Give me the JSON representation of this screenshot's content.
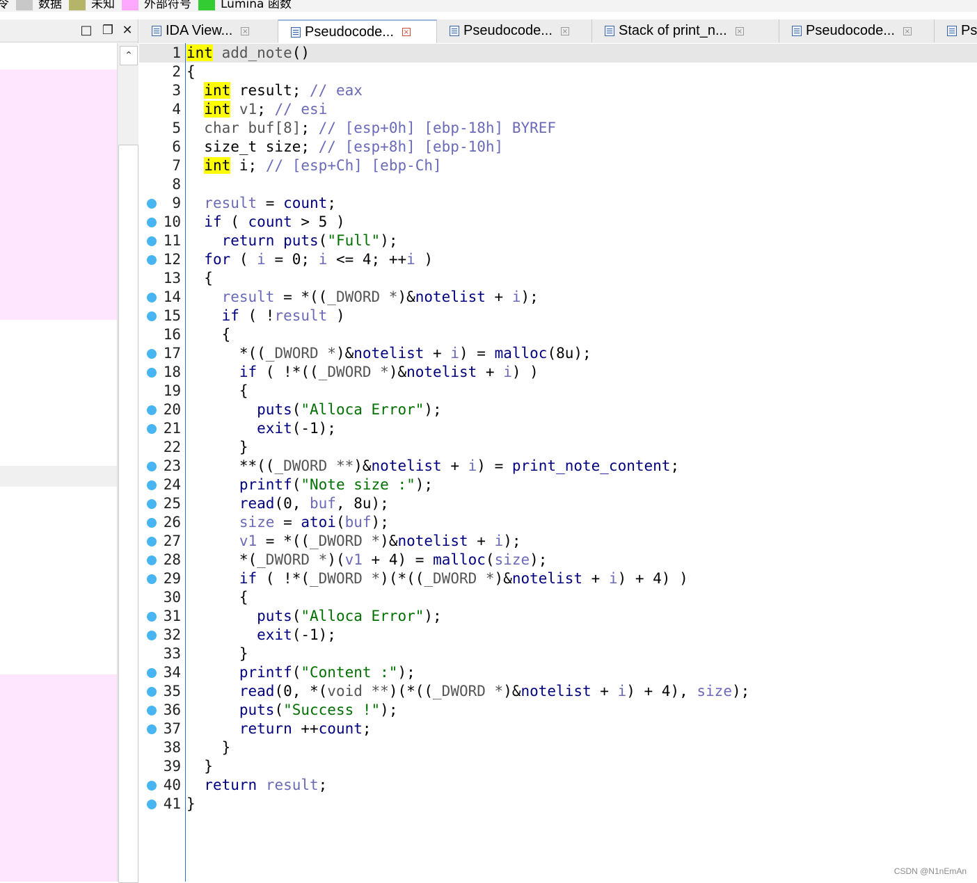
{
  "legend": {
    "items": [
      {
        "label": "令",
        "color": ""
      },
      {
        "label": "数据",
        "color": "#c8c8c8"
      },
      {
        "label": "未知",
        "color": "#b5b56a"
      },
      {
        "label": "外部符号",
        "color": "#ffa8ff"
      },
      {
        "label": "Lumina 函数",
        "color": "#33cc33"
      }
    ]
  },
  "left_panel": {
    "band_colors": {
      "pink": "#ffe6ff",
      "gray": "#f0f0f0"
    }
  },
  "tabs": [
    {
      "label": "IDA View...",
      "active": false
    },
    {
      "label": "Pseudocode...",
      "active": true
    },
    {
      "label": "Pseudocode...",
      "active": false
    },
    {
      "label": "Stack of print_n...",
      "active": false
    },
    {
      "label": "Pseudocode...",
      "active": false
    },
    {
      "label": "Ps",
      "active": false
    }
  ],
  "code": {
    "lines": [
      {
        "n": "1",
        "bp": false,
        "t": [
          [
            "ty",
            "int"
          ],
          [
            "pl",
            " "
          ],
          [
            "gy",
            "add_note"
          ],
          [
            "pl",
            "()"
          ]
        ]
      },
      {
        "n": "2",
        "bp": false,
        "t": [
          [
            "pl",
            "{"
          ]
        ]
      },
      {
        "n": "3",
        "bp": false,
        "t": [
          [
            "pl",
            "  "
          ],
          [
            "ty",
            "int"
          ],
          [
            "pl",
            " result; "
          ],
          [
            "cm",
            "// eax"
          ]
        ]
      },
      {
        "n": "4",
        "bp": false,
        "t": [
          [
            "pl",
            "  "
          ],
          [
            "ty",
            "int"
          ],
          [
            "pl",
            " "
          ],
          [
            "gy",
            "v1"
          ],
          [
            "pl",
            "; "
          ],
          [
            "cm",
            "// esi"
          ]
        ]
      },
      {
        "n": "5",
        "bp": false,
        "t": [
          [
            "pl",
            "  "
          ],
          [
            "gy",
            "char buf[8]"
          ],
          [
            "pl",
            "; "
          ],
          [
            "cm",
            "// [esp+0h] [ebp-18h] BYREF"
          ]
        ]
      },
      {
        "n": "6",
        "bp": false,
        "t": [
          [
            "pl",
            "  size_t size; "
          ],
          [
            "cm",
            "// [esp+8h] [ebp-10h]"
          ]
        ]
      },
      {
        "n": "7",
        "bp": false,
        "t": [
          [
            "pl",
            "  "
          ],
          [
            "ty",
            "int"
          ],
          [
            "pl",
            " i; "
          ],
          [
            "cm",
            "// [esp+Ch] [ebp-Ch]"
          ]
        ]
      },
      {
        "n": "8",
        "bp": false,
        "t": []
      },
      {
        "n": "9",
        "bp": true,
        "t": [
          [
            "pl",
            "  "
          ],
          [
            "vr",
            "result"
          ],
          [
            "pl",
            " = "
          ],
          [
            "kw",
            "count"
          ],
          [
            "pl",
            ";"
          ]
        ]
      },
      {
        "n": "10",
        "bp": true,
        "t": [
          [
            "pl",
            "  "
          ],
          [
            "kw",
            "if"
          ],
          [
            "pl",
            " ( "
          ],
          [
            "kw",
            "count"
          ],
          [
            "pl",
            " > 5 )"
          ]
        ]
      },
      {
        "n": "11",
        "bp": true,
        "t": [
          [
            "pl",
            "    "
          ],
          [
            "kw",
            "return"
          ],
          [
            "pl",
            " "
          ],
          [
            "fn",
            "puts"
          ],
          [
            "pl",
            "("
          ],
          [
            "st",
            "\"Full\""
          ],
          [
            "pl",
            ");"
          ]
        ]
      },
      {
        "n": "12",
        "bp": true,
        "t": [
          [
            "pl",
            "  "
          ],
          [
            "kw",
            "for"
          ],
          [
            "pl",
            " ( "
          ],
          [
            "vr",
            "i"
          ],
          [
            "pl",
            " = 0; "
          ],
          [
            "vr",
            "i"
          ],
          [
            "pl",
            " <= 4; ++"
          ],
          [
            "vr",
            "i"
          ],
          [
            "pl",
            " )"
          ]
        ]
      },
      {
        "n": "13",
        "bp": false,
        "t": [
          [
            "pl",
            "  {"
          ]
        ]
      },
      {
        "n": "14",
        "bp": true,
        "t": [
          [
            "pl",
            "    "
          ],
          [
            "vr",
            "result"
          ],
          [
            "pl",
            " = *(("
          ],
          [
            "gy",
            "_DWORD *"
          ],
          [
            "pl",
            ")&"
          ],
          [
            "kw",
            "notelist"
          ],
          [
            "pl",
            " + "
          ],
          [
            "vr",
            "i"
          ],
          [
            "pl",
            ");"
          ]
        ]
      },
      {
        "n": "15",
        "bp": true,
        "t": [
          [
            "pl",
            "    "
          ],
          [
            "kw",
            "if"
          ],
          [
            "pl",
            " ( !"
          ],
          [
            "vr",
            "result"
          ],
          [
            "pl",
            " )"
          ]
        ]
      },
      {
        "n": "16",
        "bp": false,
        "t": [
          [
            "pl",
            "    {"
          ]
        ]
      },
      {
        "n": "17",
        "bp": true,
        "t": [
          [
            "pl",
            "      *(("
          ],
          [
            "gy",
            "_DWORD *"
          ],
          [
            "pl",
            ")&"
          ],
          [
            "kw",
            "notelist"
          ],
          [
            "pl",
            " + "
          ],
          [
            "vr",
            "i"
          ],
          [
            "pl",
            ") = "
          ],
          [
            "fn",
            "malloc"
          ],
          [
            "pl",
            "(8u);"
          ]
        ]
      },
      {
        "n": "18",
        "bp": true,
        "t": [
          [
            "pl",
            "      "
          ],
          [
            "kw",
            "if"
          ],
          [
            "pl",
            " ( !*(("
          ],
          [
            "gy",
            "_DWORD *"
          ],
          [
            "pl",
            ")&"
          ],
          [
            "kw",
            "notelist"
          ],
          [
            "pl",
            " + "
          ],
          [
            "vr",
            "i"
          ],
          [
            "pl",
            ") )"
          ]
        ]
      },
      {
        "n": "19",
        "bp": false,
        "t": [
          [
            "pl",
            "      {"
          ]
        ]
      },
      {
        "n": "20",
        "bp": true,
        "t": [
          [
            "pl",
            "        "
          ],
          [
            "fn",
            "puts"
          ],
          [
            "pl",
            "("
          ],
          [
            "st",
            "\"Alloca Error\""
          ],
          [
            "pl",
            ");"
          ]
        ]
      },
      {
        "n": "21",
        "bp": true,
        "t": [
          [
            "pl",
            "        "
          ],
          [
            "fn",
            "exit"
          ],
          [
            "pl",
            "(-1);"
          ]
        ]
      },
      {
        "n": "22",
        "bp": false,
        "t": [
          [
            "pl",
            "      }"
          ]
        ]
      },
      {
        "n": "23",
        "bp": true,
        "t": [
          [
            "pl",
            "      **(("
          ],
          [
            "gy",
            "_DWORD **"
          ],
          [
            "pl",
            ")&"
          ],
          [
            "kw",
            "notelist"
          ],
          [
            "pl",
            " + "
          ],
          [
            "vr",
            "i"
          ],
          [
            "pl",
            ") = "
          ],
          [
            "kw",
            "print_note_content"
          ],
          [
            "pl",
            ";"
          ]
        ]
      },
      {
        "n": "24",
        "bp": true,
        "t": [
          [
            "pl",
            "      "
          ],
          [
            "fn",
            "printf"
          ],
          [
            "pl",
            "("
          ],
          [
            "st",
            "\"Note size :\""
          ],
          [
            "pl",
            ");"
          ]
        ]
      },
      {
        "n": "25",
        "bp": true,
        "t": [
          [
            "pl",
            "      "
          ],
          [
            "fn",
            "read"
          ],
          [
            "pl",
            "(0, "
          ],
          [
            "vr",
            "buf"
          ],
          [
            "pl",
            ", 8u);"
          ]
        ]
      },
      {
        "n": "26",
        "bp": true,
        "t": [
          [
            "pl",
            "      "
          ],
          [
            "vr",
            "size"
          ],
          [
            "pl",
            " = "
          ],
          [
            "fn",
            "atoi"
          ],
          [
            "pl",
            "("
          ],
          [
            "vr",
            "buf"
          ],
          [
            "pl",
            ");"
          ]
        ]
      },
      {
        "n": "27",
        "bp": true,
        "t": [
          [
            "pl",
            "      "
          ],
          [
            "vr",
            "v1"
          ],
          [
            "pl",
            " = *(("
          ],
          [
            "gy",
            "_DWORD *"
          ],
          [
            "pl",
            ")&"
          ],
          [
            "kw",
            "notelist"
          ],
          [
            "pl",
            " + "
          ],
          [
            "vr",
            "i"
          ],
          [
            "pl",
            ");"
          ]
        ]
      },
      {
        "n": "28",
        "bp": true,
        "t": [
          [
            "pl",
            "      *("
          ],
          [
            "gy",
            "_DWORD *"
          ],
          [
            "pl",
            ")("
          ],
          [
            "vr",
            "v1"
          ],
          [
            "pl",
            " + 4) = "
          ],
          [
            "fn",
            "malloc"
          ],
          [
            "pl",
            "("
          ],
          [
            "vr",
            "size"
          ],
          [
            "pl",
            ");"
          ]
        ]
      },
      {
        "n": "29",
        "bp": true,
        "t": [
          [
            "pl",
            "      "
          ],
          [
            "kw",
            "if"
          ],
          [
            "pl",
            " ( !*("
          ],
          [
            "gy",
            "_DWORD *"
          ],
          [
            "pl",
            ")(*(("
          ],
          [
            "gy",
            "_DWORD *"
          ],
          [
            "pl",
            ")&"
          ],
          [
            "kw",
            "notelist"
          ],
          [
            "pl",
            " + "
          ],
          [
            "vr",
            "i"
          ],
          [
            "pl",
            ") + 4) )"
          ]
        ]
      },
      {
        "n": "30",
        "bp": false,
        "t": [
          [
            "pl",
            "      {"
          ]
        ]
      },
      {
        "n": "31",
        "bp": true,
        "t": [
          [
            "pl",
            "        "
          ],
          [
            "fn",
            "puts"
          ],
          [
            "pl",
            "("
          ],
          [
            "st",
            "\"Alloca Error\""
          ],
          [
            "pl",
            ");"
          ]
        ]
      },
      {
        "n": "32",
        "bp": true,
        "t": [
          [
            "pl",
            "        "
          ],
          [
            "fn",
            "exit"
          ],
          [
            "pl",
            "(-1);"
          ]
        ]
      },
      {
        "n": "33",
        "bp": false,
        "t": [
          [
            "pl",
            "      }"
          ]
        ]
      },
      {
        "n": "34",
        "bp": true,
        "t": [
          [
            "pl",
            "      "
          ],
          [
            "fn",
            "printf"
          ],
          [
            "pl",
            "("
          ],
          [
            "st",
            "\"Content :\""
          ],
          [
            "pl",
            ");"
          ]
        ]
      },
      {
        "n": "35",
        "bp": true,
        "t": [
          [
            "pl",
            "      "
          ],
          [
            "fn",
            "read"
          ],
          [
            "pl",
            "(0, *("
          ],
          [
            "gy",
            "void **"
          ],
          [
            "pl",
            ")(*(("
          ],
          [
            "gy",
            "_DWORD *"
          ],
          [
            "pl",
            ")&"
          ],
          [
            "kw",
            "notelist"
          ],
          [
            "pl",
            " + "
          ],
          [
            "vr",
            "i"
          ],
          [
            "pl",
            ") + 4), "
          ],
          [
            "vr",
            "size"
          ],
          [
            "pl",
            ");"
          ]
        ]
      },
      {
        "n": "36",
        "bp": true,
        "t": [
          [
            "pl",
            "      "
          ],
          [
            "fn",
            "puts"
          ],
          [
            "pl",
            "("
          ],
          [
            "st",
            "\"Success !\""
          ],
          [
            "pl",
            ");"
          ]
        ]
      },
      {
        "n": "37",
        "bp": true,
        "t": [
          [
            "pl",
            "      "
          ],
          [
            "kw",
            "return"
          ],
          [
            "pl",
            " ++"
          ],
          [
            "kw",
            "count"
          ],
          [
            "pl",
            ";"
          ]
        ]
      },
      {
        "n": "38",
        "bp": false,
        "t": [
          [
            "pl",
            "    }"
          ]
        ]
      },
      {
        "n": "39",
        "bp": false,
        "t": [
          [
            "pl",
            "  }"
          ]
        ]
      },
      {
        "n": "40",
        "bp": true,
        "t": [
          [
            "pl",
            "  "
          ],
          [
            "kw",
            "return"
          ],
          [
            "pl",
            " "
          ],
          [
            "vr",
            "result"
          ],
          [
            "pl",
            ";"
          ]
        ]
      },
      {
        "n": "41",
        "bp": true,
        "t": [
          [
            "pl",
            "}"
          ]
        ]
      }
    ]
  },
  "watermark": "CSDN @N1nEmAn"
}
